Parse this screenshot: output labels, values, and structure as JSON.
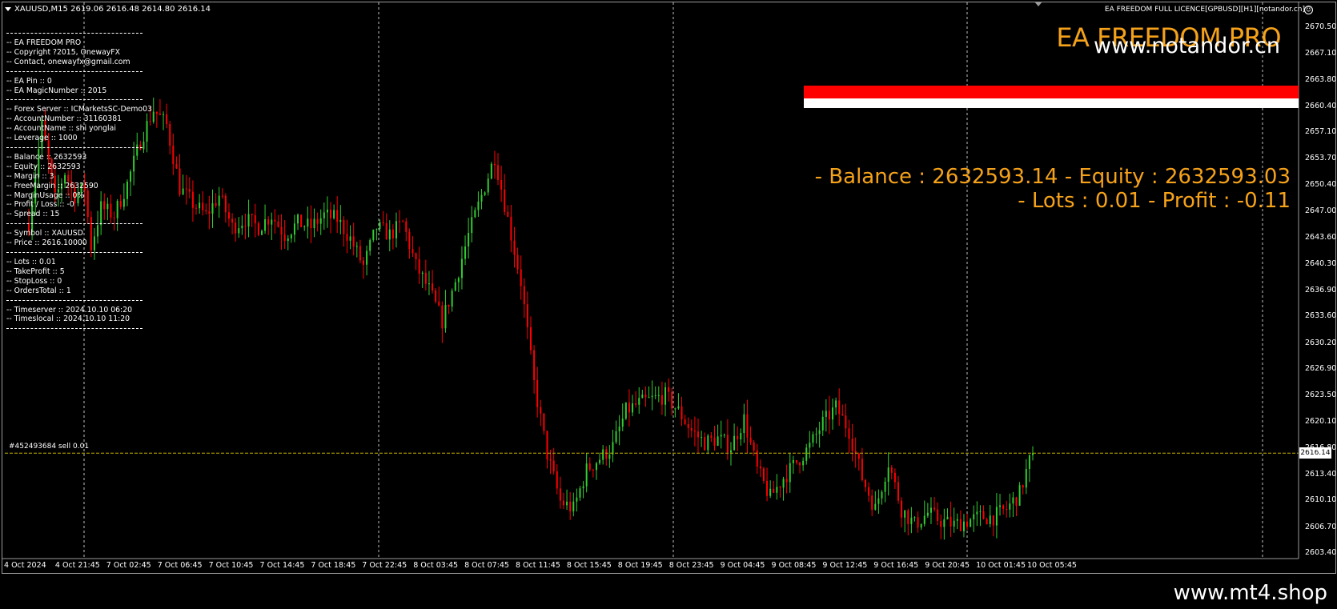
{
  "title_bar": "XAUUSD,M15  2619.06 2616.48 2614.80 2616.14",
  "licence": "EA FREEDOM FULL LICENCE[GPBUSD][H1][notandor.cn]",
  "brand": "EA FREEDOM PRO",
  "site_overlay": "www.notandor.cn",
  "info_line1": "- Balance : 2632593.14 - Equity : 2632593.03",
  "info_line2": "- Lots : 0.01 - Profit : -0.11",
  "trade_label": "#452493684 sell 0.01",
  "current_price": "2616.14",
  "footer": "www.mt4.shop",
  "panel": {
    "name": "-- EA FREEDOM PRO",
    "copyright": "-- Copyright ?2015, OnewayFX",
    "contact": "-- Contact, onewayfx@gmail.com",
    "pin": "-- EA Pin :: 0",
    "magic": "-- EA MagicNumber :: 2015",
    "server": "-- Forex Server :: ICMarketsSC-Demo03",
    "account_number": "-- AccountNumber :: 31160381",
    "account_name": "-- AccountName :: shi yonglai",
    "leverage": "-- Leverage :: 1000",
    "balance": "-- Balance :: 2632593",
    "equity": "-- Equity :: 2632593",
    "margin": "-- Margin :: 3",
    "free_margin": "-- FreeMargin :: 2632590",
    "margin_usage": "-- MarginUsage :: 0%",
    "profit_loss": "-- Profit / Loss :: -0",
    "spread": "-- Spread :: 15",
    "symbol": "-- Symbol :: XAUUSD",
    "price": "-- Price :: 2616.10000",
    "lots": "-- Lots :: 0.01",
    "take_profit": "-- TakeProfit :: 5",
    "stop_loss": "-- StopLoss :: 0",
    "orders_total": "-- OrdersTotal :: 1",
    "timeserver": "-- Timeserver :: 2024.10.10 06:20",
    "timelocal": "-- Timeslocal :: 2024.10.10 11:20"
  },
  "price_axis": [
    "2670.50",
    "2667.10",
    "2663.80",
    "2660.40",
    "2657.10",
    "2653.70",
    "2650.40",
    "2647.00",
    "2643.60",
    "2640.30",
    "2636.90",
    "2633.60",
    "2630.20",
    "2626.90",
    "2623.50",
    "2620.10",
    "2616.80",
    "2613.40",
    "2610.10",
    "2606.70",
    "2603.40"
  ],
  "time_axis": [
    "4 Oct 2024",
    "4 Oct 21:45",
    "7 Oct 02:45",
    "7 Oct 06:45",
    "7 Oct 10:45",
    "7 Oct 14:45",
    "7 Oct 18:45",
    "7 Oct 22:45",
    "8 Oct 03:45",
    "8 Oct 07:45",
    "8 Oct 11:45",
    "8 Oct 15:45",
    "8 Oct 19:45",
    "8 Oct 23:45",
    "9 Oct 04:45",
    "9 Oct 08:45",
    "9 Oct 12:45",
    "9 Oct 16:45",
    "9 Oct 20:45",
    "10 Oct 01:45",
    "10 Oct 05:45"
  ],
  "colors": {
    "bull": "#32cd32",
    "bear": "#ff0000",
    "accent": "#f5a21a",
    "grid": "#c0c0c0"
  },
  "chart_data": {
    "type": "candlestick",
    "symbol": "XAUUSD",
    "timeframe": "M15",
    "ylim": [
      2603.4,
      2670.5
    ],
    "trend_anchors": [
      [
        0,
        2645.5
      ],
      [
        4,
        2658.0
      ],
      [
        8,
        2648.5
      ],
      [
        11,
        2652.0
      ],
      [
        14,
        2649.0
      ],
      [
        17,
        2650.0
      ],
      [
        19,
        2642.5
      ],
      [
        22,
        2647.5
      ],
      [
        26,
        2646.5
      ],
      [
        30,
        2650.5
      ],
      [
        34,
        2656.0
      ],
      [
        38,
        2660.0
      ],
      [
        42,
        2658.0
      ],
      [
        46,
        2650.0
      ],
      [
        50,
        2648.0
      ],
      [
        54,
        2646.5
      ],
      [
        58,
        2649.0
      ],
      [
        62,
        2645.0
      ],
      [
        66,
        2646.0
      ],
      [
        70,
        2645.0
      ],
      [
        74,
        2646.5
      ],
      [
        78,
        2644.0
      ],
      [
        82,
        2645.5
      ],
      [
        86,
        2645.0
      ],
      [
        90,
        2646.5
      ],
      [
        94,
        2646.0
      ],
      [
        98,
        2643.5
      ],
      [
        102,
        2640.0
      ],
      [
        106,
        2645.0
      ],
      [
        110,
        2644.0
      ],
      [
        114,
        2645.5
      ],
      [
        118,
        2640.0
      ],
      [
        122,
        2637.0
      ],
      [
        126,
        2633.0
      ],
      [
        130,
        2638.0
      ],
      [
        134,
        2644.0
      ],
      [
        138,
        2649.0
      ],
      [
        142,
        2654.0
      ],
      [
        146,
        2646.0
      ],
      [
        150,
        2638.0
      ],
      [
        154,
        2625.0
      ],
      [
        158,
        2616.0
      ],
      [
        162,
        2610.0
      ],
      [
        166,
        2609.0
      ],
      [
        170,
        2614.0
      ],
      [
        174,
        2615.5
      ],
      [
        178,
        2617.0
      ],
      [
        182,
        2621.5
      ],
      [
        186,
        2622.5
      ],
      [
        190,
        2623.0
      ],
      [
        194,
        2623.5
      ],
      [
        198,
        2621.5
      ],
      [
        202,
        2619.0
      ],
      [
        206,
        2617.5
      ],
      [
        210,
        2618.0
      ],
      [
        214,
        2617.0
      ],
      [
        218,
        2620.5
      ],
      [
        222,
        2614.0
      ],
      [
        226,
        2610.5
      ],
      [
        230,
        2613.0
      ],
      [
        234,
        2615.0
      ],
      [
        238,
        2617.0
      ],
      [
        242,
        2620.0
      ],
      [
        246,
        2622.0
      ],
      [
        250,
        2619.0
      ],
      [
        254,
        2613.0
      ],
      [
        258,
        2609.0
      ],
      [
        262,
        2615.0
      ],
      [
        266,
        2609.0
      ],
      [
        270,
        2607.0
      ],
      [
        274,
        2608.5
      ],
      [
        278,
        2607.5
      ],
      [
        282,
        2607.0
      ],
      [
        286,
        2607.5
      ],
      [
        290,
        2608.0
      ],
      [
        294,
        2608.0
      ],
      [
        298,
        2609.0
      ],
      [
        302,
        2611.0
      ],
      [
        306,
        2616.5
      ]
    ],
    "last_close": 2616.14
  }
}
